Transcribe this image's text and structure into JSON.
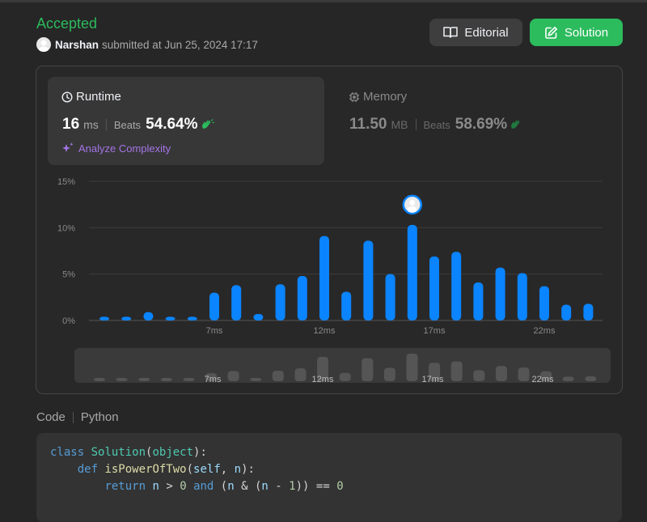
{
  "submission": {
    "status": "Accepted",
    "username": "Narshan",
    "submitted_text": "submitted at Jun 25, 2024 17:17"
  },
  "buttons": {
    "editorial": "Editorial",
    "solution": "Solution"
  },
  "runtime": {
    "title": "Runtime",
    "value": "16",
    "unit": "ms",
    "beats_label": "Beats",
    "beats_pct": "54.64%",
    "analyze": "Analyze Complexity"
  },
  "memory": {
    "title": "Memory",
    "value": "11.50",
    "unit": "MB",
    "beats_label": "Beats",
    "beats_pct": "58.69%"
  },
  "code": {
    "label": "Code",
    "language": "Python",
    "lines": [
      "class Solution(object):",
      "    def isPowerOfTwo(self, n):",
      "        return n > 0 and (n & (n - 1)) == 0"
    ]
  },
  "colors": {
    "accepted": "#2cbb5d",
    "bar": "#0a84ff",
    "analyze": "#a474e6"
  },
  "chart_data": {
    "type": "bar",
    "y_ticks": [
      "15%",
      "10%",
      "5%",
      "0%"
    ],
    "ylim": [
      0,
      15
    ],
    "x_tick_labels": [
      {
        "label": "7ms",
        "index": 5
      },
      {
        "label": "12ms",
        "index": 10
      },
      {
        "label": "17ms",
        "index": 15
      },
      {
        "label": "22ms",
        "index": 20
      }
    ],
    "values": [
      0.4,
      0.4,
      0.9,
      0.4,
      0.4,
      3.0,
      3.8,
      0.7,
      3.9,
      4.8,
      9.1,
      3.1,
      8.6,
      5.0,
      10.3,
      6.9,
      7.4,
      4.1,
      5.7,
      5.1,
      3.7,
      1.7,
      1.8
    ],
    "selected_index": 14,
    "grid": true
  }
}
